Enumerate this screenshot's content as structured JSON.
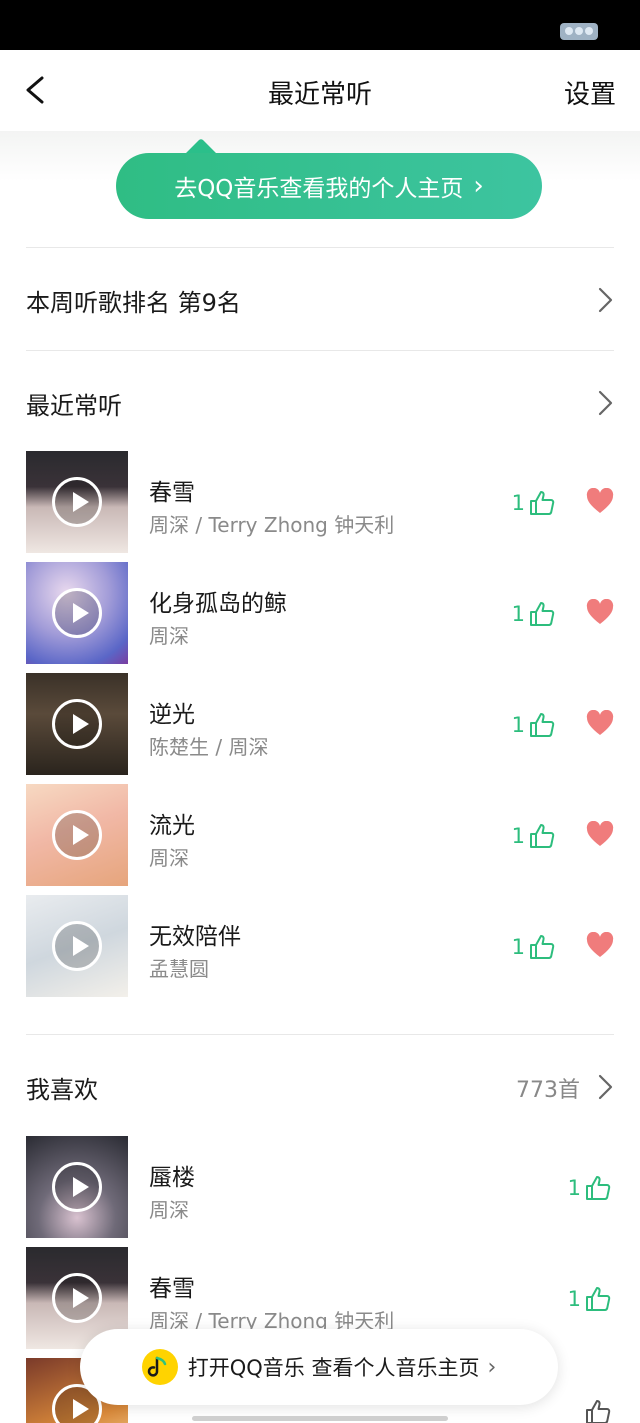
{
  "nav": {
    "title": "最近常听",
    "settings": "设置"
  },
  "banner": {
    "text": "去QQ音乐查看我的个人主页",
    "chevron": "›"
  },
  "weekly_rank": {
    "label": "本周听歌排名 第9名"
  },
  "recent": {
    "header": "最近常听",
    "songs": [
      {
        "title": "春雪",
        "artist": "周深 / Terry Zhong 钟天利",
        "likes": "1"
      },
      {
        "title": "化身孤岛的鲸",
        "artist": "周深",
        "likes": "1"
      },
      {
        "title": "逆光",
        "artist": "陈楚生 / 周深",
        "likes": "1"
      },
      {
        "title": "流光",
        "artist": "周深",
        "likes": "1"
      },
      {
        "title": "无效陪伴",
        "artist": "孟慧圆",
        "likes": "1"
      }
    ]
  },
  "favorites": {
    "header": "我喜欢",
    "count": "773首",
    "songs": [
      {
        "title": "蜃楼",
        "artist": "周深",
        "likes": "1"
      },
      {
        "title": "春雪",
        "artist": "周深 / Terry Zhong 钟天利",
        "likes": "1"
      }
    ]
  },
  "open_app_bar": {
    "text": "打开QQ音乐 查看个人音乐主页",
    "chevron": "›"
  },
  "colors": {
    "accent_green": "#2dbd7d",
    "heart_pink": "#f07c7c"
  }
}
